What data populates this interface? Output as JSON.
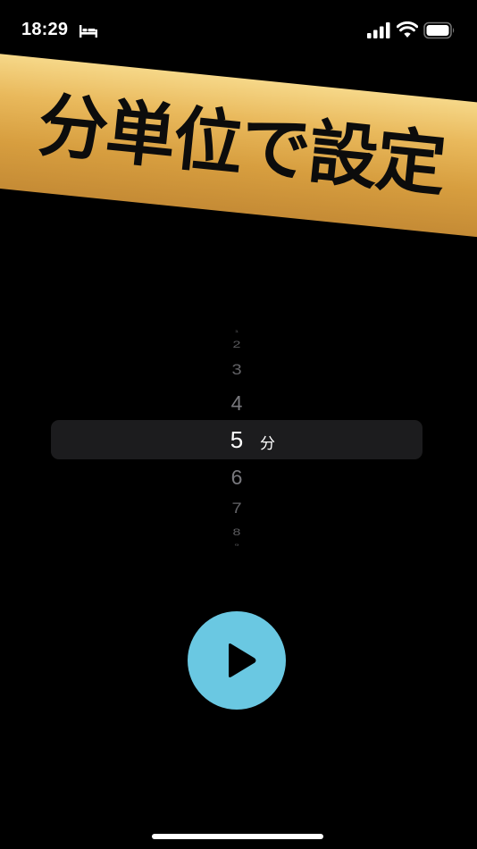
{
  "status_bar": {
    "time": "18:29",
    "icons": [
      "bed-icon",
      "cellular-signal-icon",
      "wifi-icon",
      "battery-icon"
    ]
  },
  "banner": {
    "text": "分単位で設定"
  },
  "picker": {
    "numbers": [
      "1",
      "2",
      "3",
      "4",
      "5",
      "6",
      "7",
      "8",
      "9"
    ],
    "selected": "5",
    "unit": "分"
  },
  "controls": {
    "play_icon": "play-icon"
  },
  "colors": {
    "background": "#000000",
    "banner_gold": "#e3ad4f",
    "play_button": "#6ac8e2",
    "picker_highlight": "#1c1c1e"
  }
}
